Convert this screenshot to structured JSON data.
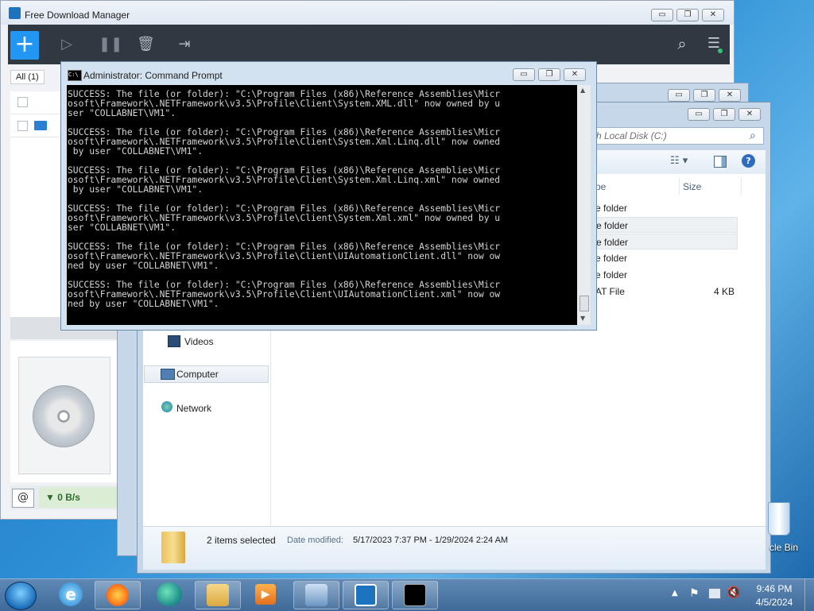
{
  "fdm": {
    "title": "Free Download Manager",
    "tab_all": "All (1)",
    "speed": "▼ 0 B/s",
    "window_buttons": [
      "▭",
      "❐",
      "✕"
    ]
  },
  "explorer": {
    "search_placeholder": "rch Local Disk (C:)",
    "columns": {
      "type": "pe",
      "size": "Size"
    },
    "files": [
      {
        "type": "e folder",
        "size": "",
        "selected": false
      },
      {
        "type": "e folder",
        "size": "",
        "selected": true
      },
      {
        "type": "e folder",
        "size": "",
        "selected": true
      },
      {
        "type": "e folder",
        "size": "",
        "selected": false
      },
      {
        "type": "e folder",
        "size": "",
        "selected": false
      },
      {
        "type": "AT File",
        "size": "4 KB",
        "selected": false
      }
    ],
    "nav": {
      "videos": "Videos",
      "computer": "Computer",
      "network": "Network"
    },
    "details": {
      "selected": "2 items selected",
      "date_label": "Date modified:",
      "date_value": "5/17/2023 7:37 PM - 1/29/2024 2:24 AM"
    }
  },
  "cmd": {
    "title": "Administrator:  Command Prompt",
    "output": "SUCCESS: The file (or folder): \"C:\\Program Files (x86)\\Reference Assemblies\\Micr\nosoft\\Framework\\.NETFramework\\v3.5\\Profile\\Client\\System.XML.dll\" now owned by u\nser \"COLLABNET\\VM1\".\n\nSUCCESS: The file (or folder): \"C:\\Program Files (x86)\\Reference Assemblies\\Micr\nosoft\\Framework\\.NETFramework\\v3.5\\Profile\\Client\\System.Xml.Linq.dll\" now owned\n by user \"COLLABNET\\VM1\".\n\nSUCCESS: The file (or folder): \"C:\\Program Files (x86)\\Reference Assemblies\\Micr\nosoft\\Framework\\.NETFramework\\v3.5\\Profile\\Client\\System.Xml.Linq.xml\" now owned\n by user \"COLLABNET\\VM1\".\n\nSUCCESS: The file (or folder): \"C:\\Program Files (x86)\\Reference Assemblies\\Micr\nosoft\\Framework\\.NETFramework\\v3.5\\Profile\\Client\\System.Xml.xml\" now owned by u\nser \"COLLABNET\\VM1\".\n\nSUCCESS: The file (or folder): \"C:\\Program Files (x86)\\Reference Assemblies\\Micr\nosoft\\Framework\\.NETFramework\\v3.5\\Profile\\Client\\UIAutomationClient.dll\" now ow\nned by user \"COLLABNET\\VM1\".\n\nSUCCESS: The file (or folder): \"C:\\Program Files (x86)\\Reference Assemblies\\Micr\nosoft\\Framework\\.NETFramework\\v3.5\\Profile\\Client\\UIAutomationClient.xml\" now ow\nned by user \"COLLABNET\\VM1\"."
  },
  "desktop": {
    "recycle_label": "cle Bin"
  },
  "taskbar": {
    "time": "9:46 PM",
    "date": "4/5/2024"
  },
  "colors": {
    "fdm_toolbar": "#303842",
    "fdm_accent": "#2196f3",
    "console_bg": "#000000"
  }
}
